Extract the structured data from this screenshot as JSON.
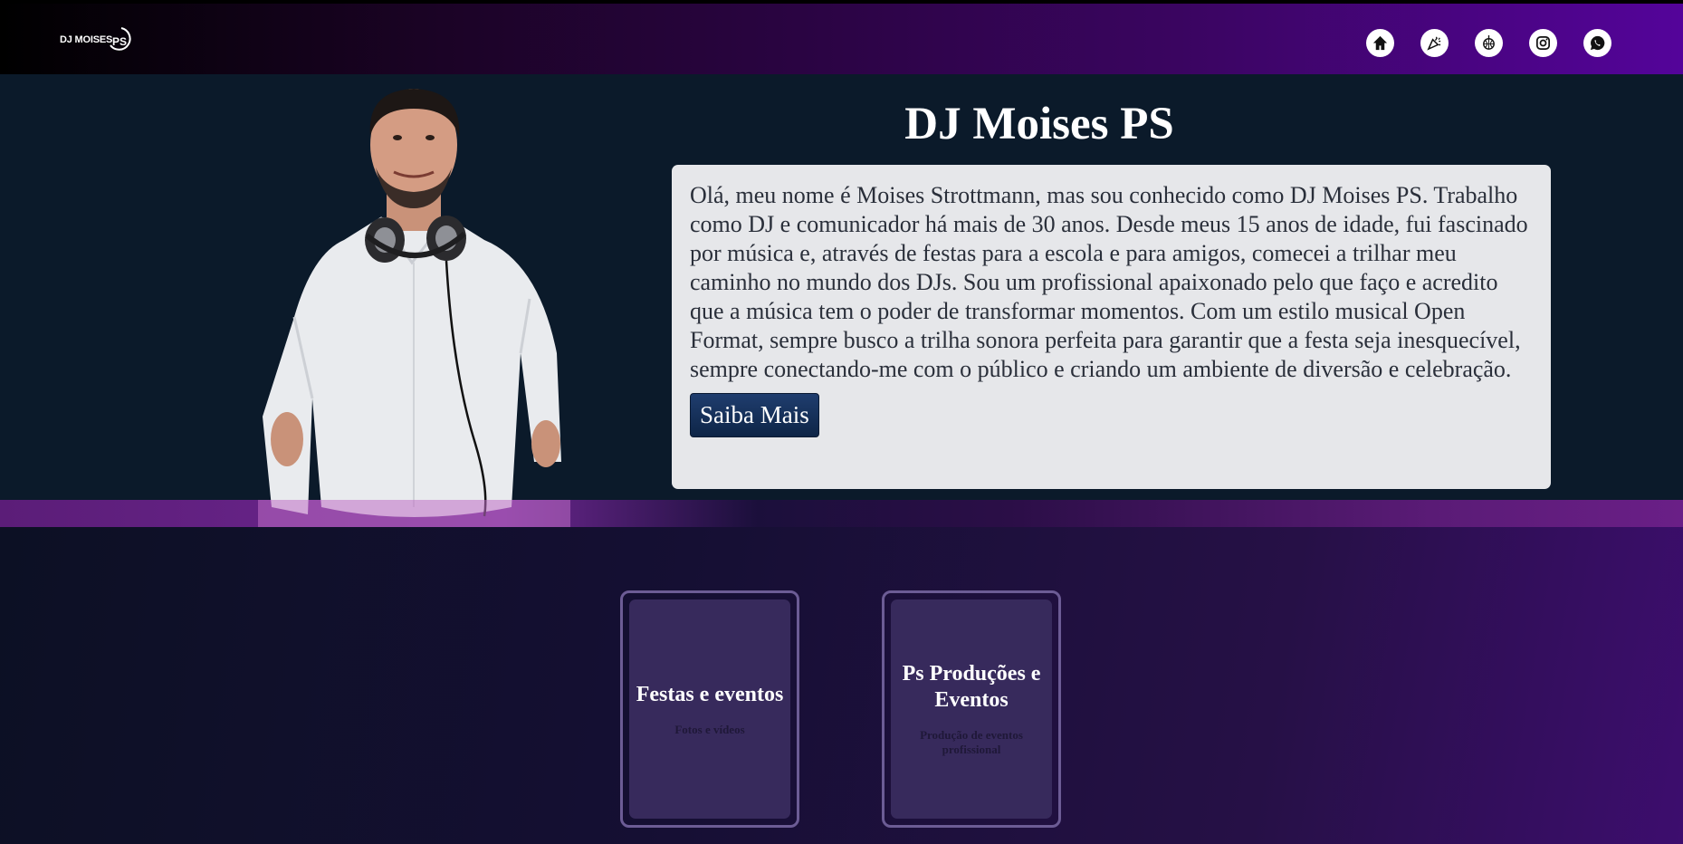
{
  "header": {
    "logo_text": "DJ MOISES",
    "logo_mark_text": "PS",
    "nav": [
      {
        "icon": "home-icon"
      },
      {
        "icon": "party-popper-icon"
      },
      {
        "icon": "disco-ball-icon"
      },
      {
        "icon": "instagram-icon"
      },
      {
        "icon": "whatsapp-icon"
      }
    ]
  },
  "hero": {
    "title": "DJ Moises PS",
    "about": "Olá, meu nome é Moises Strottmann, mas sou conhecido como DJ Moises PS. Trabalho como DJ e comunicador há mais de 30 anos. Desde meus 15 anos de idade, fui fascinado por música e, através de festas para a escola e para amigos, comecei a trilhar meu caminho no mundo dos DJs. Sou um profissional apaixonado pelo que faço e acredito que a música tem o poder de transformar momentos. Com um estilo musical Open Format, sempre busco a trilha sonora perfeita para garantir que a festa seja inesquecível, sempre conectando-me com o público e criando um ambiente de diversão e celebração.",
    "button": "Saiba Mais"
  },
  "cards": [
    {
      "title": "Festas e eventos",
      "subtitle": "Fotos e vídeos"
    },
    {
      "title": "Ps Produções e Eventos",
      "subtitle": "Produção de eventos profissional"
    }
  ],
  "colors": {
    "header_end": "#54049a",
    "hero_bg": "#0b1a2a",
    "button_bg": "#1f3d6e",
    "card_bg": "#372a5c"
  }
}
